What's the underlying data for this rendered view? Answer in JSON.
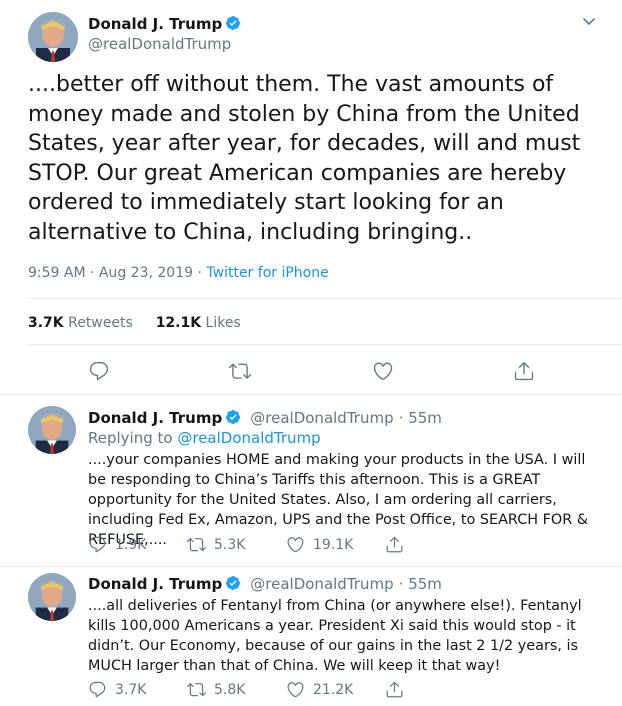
{
  "main_tweet": {
    "author_name": "Donald J. Trump",
    "author_handle": "@realDonaldTrump",
    "text": "....better off without them. The vast amounts of money made and stolen by China from the United States, year after year, for decades, will and must STOP. Our great American companies are hereby ordered to immediately start looking for an alternative to China, including bringing..",
    "time": "9:59 AM · Aug 23, 2019",
    "separator": "·",
    "source": "Twitter for iPhone",
    "retweets_count": "3.7K",
    "retweets_label": "Retweets",
    "likes_count": "12.1K",
    "likes_label": "Likes"
  },
  "replies": [
    {
      "author_name": "Donald J. Trump",
      "author_handle": "@realDonaldTrump",
      "time": "· 55m",
      "replying_label": "Replying to",
      "replying_handle": "@realDonaldTrump",
      "text": "....your companies HOME and making your products in the USA. I will be responding to China’s Tariffs this afternoon. This is a GREAT opportunity for the United States. Also, I am ordering all carriers, including Fed Ex, Amazon, UPS and the Post Office, to SEARCH FOR & REFUSE,....",
      "reply_count": "1.9K",
      "retweet_count": "5.3K",
      "like_count": "19.1K"
    },
    {
      "author_name": "Donald J. Trump",
      "author_handle": "@realDonaldTrump",
      "time": "· 55m",
      "text": "....all deliveries of Fentanyl from China (or anywhere else!). Fentanyl kills 100,000 Americans a year. President Xi said this would stop - it didn’t. Our Economy, because of our gains in the last 2 1/2 years, is MUCH larger than that of China. We will keep it that way!",
      "reply_count": "3.7K",
      "retweet_count": "5.8K",
      "like_count": "21.2K"
    }
  ],
  "icons": [
    "caret-down-icon",
    "verified-badge-icon",
    "reply-icon",
    "retweet-icon",
    "like-icon",
    "share-icon"
  ],
  "colors": {
    "link": "#1b95e0",
    "muted": "#657786",
    "text": "#14171a",
    "divider": "#e6ecf0"
  }
}
